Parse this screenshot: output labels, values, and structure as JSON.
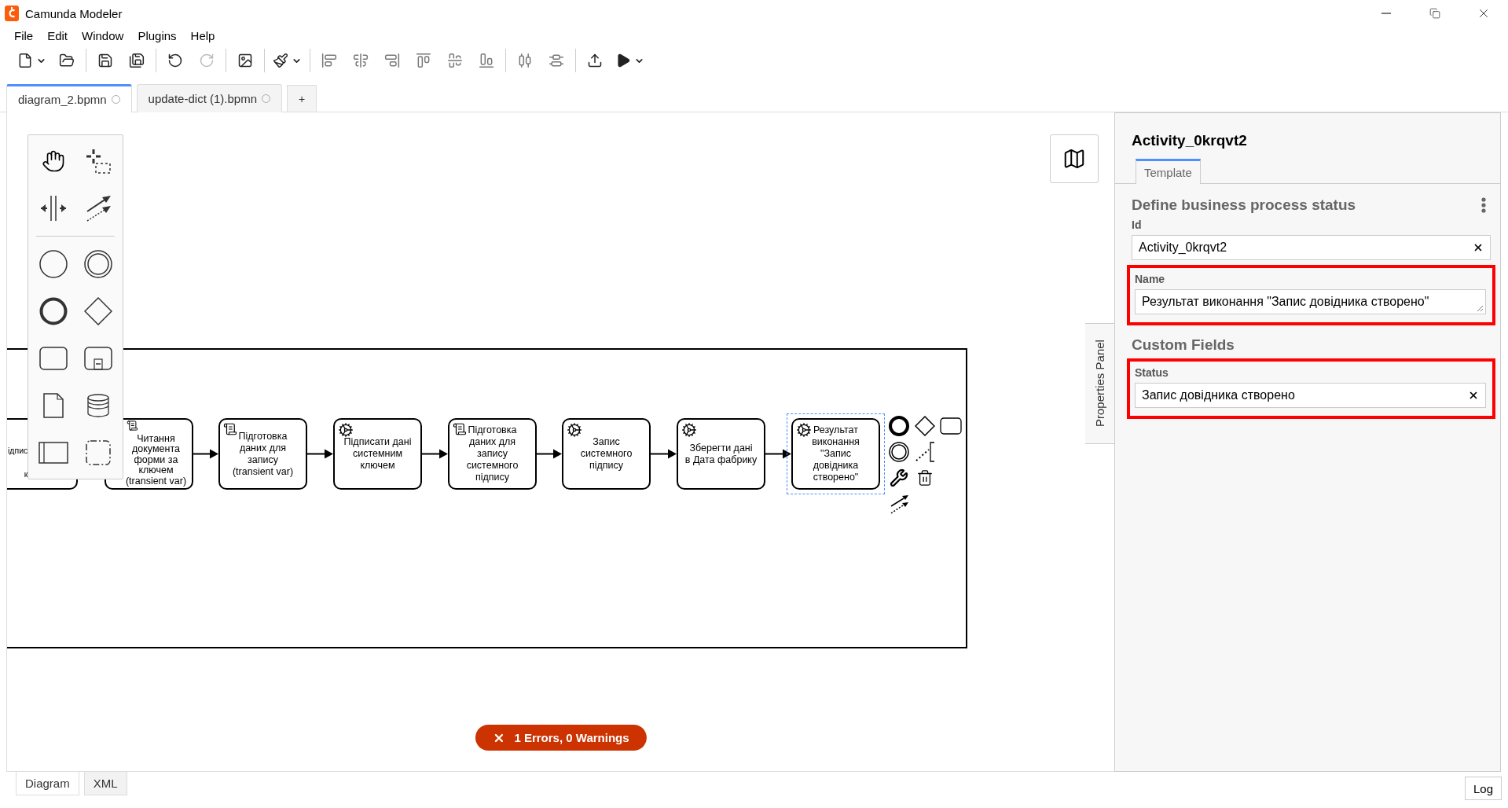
{
  "window": {
    "title": "Camunda Modeler"
  },
  "menu": [
    "File",
    "Edit",
    "Window",
    "Plugins",
    "Help"
  ],
  "toolbar": [
    [
      {
        "kind": "new",
        "dropdown": true,
        "disabled": false
      },
      {
        "kind": "open",
        "dropdown": false,
        "disabled": false
      }
    ],
    [
      {
        "kind": "save",
        "dropdown": false,
        "disabled": false
      },
      {
        "kind": "save-as",
        "dropdown": false,
        "disabled": false
      }
    ],
    [
      {
        "kind": "undo",
        "dropdown": false,
        "disabled": false
      },
      {
        "kind": "redo",
        "dropdown": false,
        "disabled": true
      }
    ],
    [
      {
        "kind": "image",
        "dropdown": false,
        "disabled": false
      }
    ],
    [
      {
        "kind": "brush",
        "dropdown": true,
        "disabled": false
      }
    ],
    [
      {
        "kind": "align-left",
        "dropdown": false,
        "disabled": false
      },
      {
        "kind": "align-center",
        "dropdown": false,
        "disabled": false
      },
      {
        "kind": "align-right",
        "dropdown": false,
        "disabled": false
      },
      {
        "kind": "align-top",
        "dropdown": false,
        "disabled": false
      },
      {
        "kind": "align-middle",
        "dropdown": false,
        "disabled": false
      },
      {
        "kind": "align-bottom",
        "dropdown": false,
        "disabled": false
      }
    ],
    [
      {
        "kind": "distribute-h",
        "dropdown": false,
        "disabled": false
      },
      {
        "kind": "distribute-v",
        "dropdown": false,
        "disabled": false
      }
    ],
    [
      {
        "kind": "deploy",
        "dropdown": false,
        "disabled": false
      },
      {
        "kind": "run",
        "dropdown": true,
        "disabled": false
      }
    ]
  ],
  "tabs": [
    {
      "label": "diagram_2.bpmn",
      "selected": true
    },
    {
      "label": "update-dict (1).bpmn",
      "selected": false
    }
  ],
  "new_tab": "+",
  "diagram": {
    "tasks": [
      {
        "kind": "cut",
        "lines": [
          "ідпис",
          "к"
        ],
        "selected": false
      },
      {
        "kind": "script",
        "lines": [
          "Читання",
          "документа",
          "форми за",
          "ключем",
          "(transient var)"
        ],
        "selected": false
      },
      {
        "kind": "script",
        "lines": [
          "Підготовка",
          "даних для",
          "запису",
          "(transient var)"
        ],
        "selected": false
      },
      {
        "kind": "service",
        "lines": [
          "Підписати дані",
          "системним",
          "ключем"
        ],
        "selected": false
      },
      {
        "kind": "script",
        "lines": [
          "Підготовка",
          "даних для",
          "запису",
          "системного",
          "підпису"
        ],
        "selected": false
      },
      {
        "kind": "service",
        "lines": [
          "Запис",
          "системного",
          "підпису"
        ],
        "selected": false
      },
      {
        "kind": "service",
        "lines": [
          "Зберегти дані",
          "в Дата фабрику"
        ],
        "selected": false
      },
      {
        "kind": "service",
        "lines": [
          "Результат",
          "виконання",
          "\"Запис",
          "довідника",
          "створено\""
        ],
        "selected": true
      }
    ],
    "lint": "1 Errors, 0 Warnings"
  },
  "properties": {
    "title": "Activity_0krqvt2",
    "side_tab": "Properties Panel",
    "tabs": [
      {
        "label": "Template",
        "selected": true
      }
    ],
    "group_title": "Define business process status",
    "fields": [
      {
        "label": "Id",
        "value": "Activity_0krqvt2",
        "kind": "input",
        "highlighted": false
      },
      {
        "label": "Name",
        "value": "Результат виконання \"Запис довідника створено\"",
        "kind": "textarea",
        "highlighted": true
      }
    ],
    "custom_heading": "Custom Fields",
    "custom_fields": [
      {
        "label": "Status",
        "value": "Запис довідника створено",
        "kind": "input",
        "highlighted": true
      }
    ]
  },
  "bottom_tabs": [
    {
      "label": "Diagram",
      "selected": true
    },
    {
      "label": "XML",
      "selected": false
    }
  ],
  "log": "Log"
}
